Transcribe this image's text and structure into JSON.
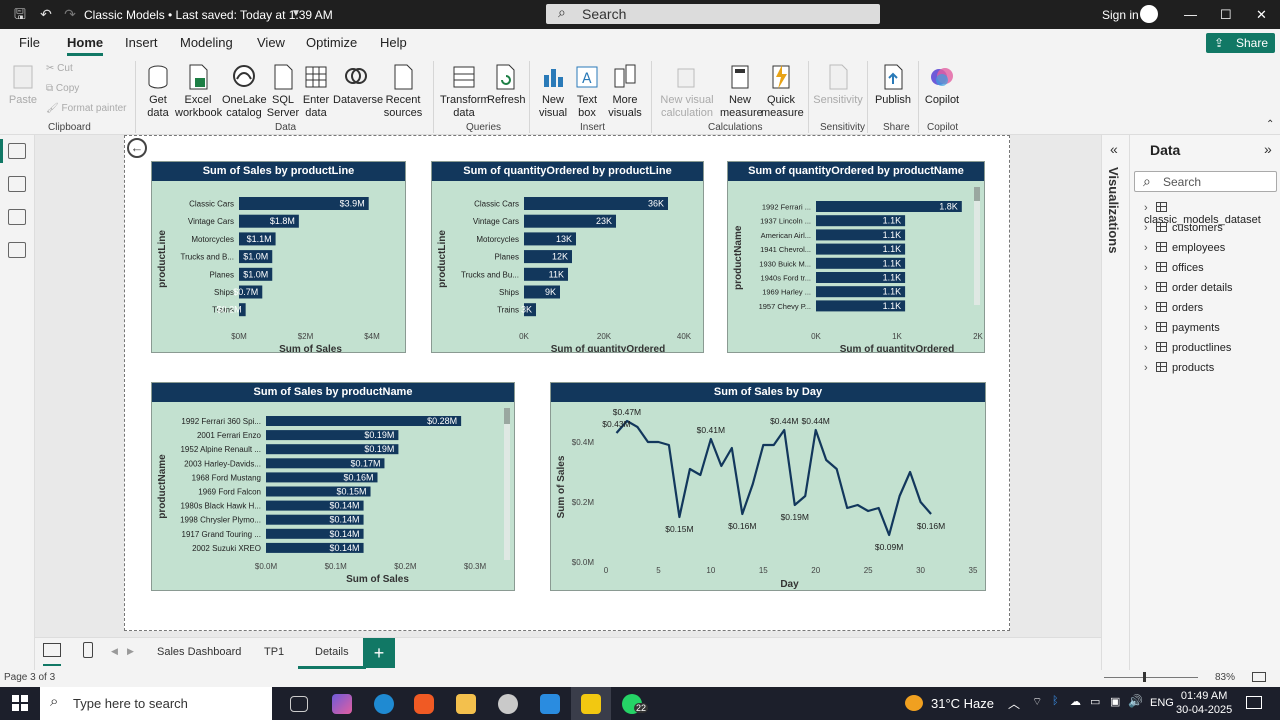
{
  "titlebar": {
    "doc_title": "Classic Models • Last saved: Today at 1:39 AM",
    "search": "Search",
    "signin": "Sign in"
  },
  "menu": {
    "file": "File",
    "home": "Home",
    "insert": "Insert",
    "modeling": "Modeling",
    "view": "View",
    "optimize": "Optimize",
    "help": "Help",
    "share": "Share"
  },
  "ribbon": {
    "paste": "Paste",
    "cut": "Cut",
    "copy": "Copy",
    "format_painter": "Format painter",
    "get_data": "Get data",
    "excel": "Excel workbook",
    "onelake": "OneLake catalog",
    "sql": "SQL Server",
    "enter_data": "Enter data",
    "dataverse": "Dataverse",
    "recent": "Recent sources",
    "transform": "Transform data",
    "refresh": "Refresh",
    "new_visual": "New visual",
    "text_box": "Text box",
    "more_visuals": "More visuals",
    "new_visual_calc": "New visual calculation",
    "new_measure": "New measure",
    "quick_measure": "Quick measure",
    "sensitivity": "Sensitivity",
    "publish": "Publish",
    "copilot": "Copilot",
    "groups": {
      "clipboard": "Clipboard",
      "data": "Data",
      "queries": "Queries",
      "insert": "Insert",
      "calculations": "Calculations",
      "sensitivity": "Sensitivity",
      "share": "Share",
      "copilot": "Copilot"
    }
  },
  "data_pane": {
    "viz_label": "Visualizations",
    "title": "Data",
    "search_placeholder": "Search",
    "tables": [
      "classic_models_dataset",
      "customers",
      "employees",
      "offices",
      "order details",
      "orders",
      "payments",
      "productlines",
      "products"
    ]
  },
  "pages": {
    "tabs": [
      "Sales Dashboard",
      "TP1",
      "Details"
    ],
    "active": "Details",
    "add": "+"
  },
  "status": {
    "page": "Page 3 of 3",
    "zoom": "83%"
  },
  "taskbar": {
    "search": "Type here to search",
    "weather": "31°C Haze",
    "lang": "ENG",
    "time": "01:49 AM",
    "date": "30-04-2025",
    "badge": "22"
  },
  "colors": {
    "bar": "#12375c",
    "chart_bg": "#c3e1d0",
    "accent": "#117865"
  },
  "chart_data": [
    {
      "type": "bar",
      "orientation": "horizontal",
      "title": "Sum of Sales by productLine",
      "xlabel": "Sum of Sales",
      "ylabel": "productLine",
      "categories": [
        "Classic Cars",
        "Vintage Cars",
        "Motorcycles",
        "Trucks and B...",
        "Planes",
        "Ships",
        "Trains"
      ],
      "values": [
        3.9,
        1.8,
        1.1,
        1.0,
        1.0,
        0.7,
        0.2
      ],
      "labels": [
        "$3.9M",
        "$1.8M",
        "$1.1M",
        "$1.0M",
        "$1.0M",
        "$0.7M",
        "$0.2M"
      ],
      "ticks": [
        "$0M",
        "$2M",
        "$4M"
      ],
      "xlim": [
        0,
        4.3
      ]
    },
    {
      "type": "bar",
      "orientation": "horizontal",
      "title": "Sum of quantityOrdered by productLine",
      "xlabel": "Sum of quantityOrdered",
      "ylabel": "productLine",
      "categories": [
        "Classic Cars",
        "Vintage Cars",
        "Motorcycles",
        "Planes",
        "Trucks and Bu...",
        "Ships",
        "Trains"
      ],
      "values": [
        36,
        23,
        13,
        12,
        11,
        9,
        3
      ],
      "labels": [
        "36K",
        "23K",
        "13K",
        "12K",
        "11K",
        "9K",
        "3K"
      ],
      "ticks": [
        "0K",
        "20K",
        "40K"
      ],
      "xlim": [
        0,
        42
      ]
    },
    {
      "type": "bar",
      "orientation": "horizontal",
      "title": "Sum of quantityOrdered by productName",
      "xlabel": "Sum of quantityOrdered",
      "ylabel": "productName",
      "categories": [
        "1992 Ferrari ...",
        "1937 Lincoln ...",
        "American Airl...",
        "1941 Chevrol...",
        "1930 Buick M...",
        "1940s Ford tr...",
        "1969 Harley ...",
        "1957 Chevy P..."
      ],
      "values": [
        1.8,
        1.1,
        1.1,
        1.1,
        1.1,
        1.1,
        1.1,
        1.1
      ],
      "labels": [
        "1.8K",
        "1.1K",
        "1.1K",
        "1.1K",
        "1.1K",
        "1.1K",
        "1.1K",
        "1.1K"
      ],
      "ticks": [
        "0K",
        "1K",
        "2K"
      ],
      "xlim": [
        0,
        2
      ]
    },
    {
      "type": "bar",
      "orientation": "horizontal",
      "title": "Sum of Sales by productName",
      "xlabel": "Sum of Sales",
      "ylabel": "productName",
      "categories": [
        "1992 Ferrari 360 Spi...",
        "2001 Ferrari Enzo",
        "1952 Alpine Renault ...",
        "2003 Harley-Davids...",
        "1968 Ford Mustang",
        "1969 Ford Falcon",
        "1980s Black Hawk H...",
        "1998 Chrysler Plymo...",
        "1917 Grand Touring ...",
        "2002 Suzuki XREO"
      ],
      "values": [
        0.28,
        0.19,
        0.19,
        0.17,
        0.16,
        0.15,
        0.14,
        0.14,
        0.14,
        0.14
      ],
      "labels": [
        "$0.28M",
        "$0.19M",
        "$0.19M",
        "$0.17M",
        "$0.16M",
        "$0.15M",
        "$0.14M",
        "$0.14M",
        "$0.14M",
        "$0.14M"
      ],
      "ticks": [
        "$0.0M",
        "$0.1M",
        "$0.2M",
        "$0.3M"
      ],
      "xlim": [
        0,
        0.32
      ]
    },
    {
      "type": "line",
      "title": "Sum of Sales by Day",
      "xlabel": "Day",
      "ylabel": "Sum of Sales",
      "x": [
        1,
        2,
        3,
        4,
        5,
        6,
        7,
        8,
        9,
        10,
        11,
        12,
        13,
        14,
        15,
        16,
        17,
        18,
        19,
        20,
        21,
        22,
        23,
        24,
        25,
        26,
        27,
        28,
        29,
        30,
        31
      ],
      "values": [
        0.43,
        0.47,
        0.45,
        0.4,
        0.4,
        0.39,
        0.15,
        0.31,
        0.29,
        0.41,
        0.32,
        0.38,
        0.16,
        0.26,
        0.39,
        0.39,
        0.44,
        0.19,
        0.22,
        0.44,
        0.34,
        0.31,
        0.18,
        0.19,
        0.17,
        0.18,
        0.09,
        0.22,
        0.3,
        0.2,
        0.16
      ],
      "point_labels": [
        {
          "x": 1,
          "text": "$0.43M"
        },
        {
          "x": 2,
          "text": "$0.47M"
        },
        {
          "x": 7,
          "text": "$0.15M"
        },
        {
          "x": 10,
          "text": "$0.41M"
        },
        {
          "x": 13,
          "text": "$0.16M"
        },
        {
          "x": 17,
          "text": "$0.44M"
        },
        {
          "x": 18,
          "text": "$0.19M"
        },
        {
          "x": 20,
          "text": "$0.44M"
        },
        {
          "x": 27,
          "text": "$0.09M"
        },
        {
          "x": 31,
          "text": "$0.16M"
        }
      ],
      "yticks": [
        "$0.0M",
        "$0.2M",
        "$0.4M"
      ],
      "xticks": [
        0,
        5,
        10,
        15,
        20,
        25,
        30,
        35
      ],
      "xlim": [
        0,
        35
      ],
      "ylim": [
        0,
        0.5
      ]
    }
  ]
}
